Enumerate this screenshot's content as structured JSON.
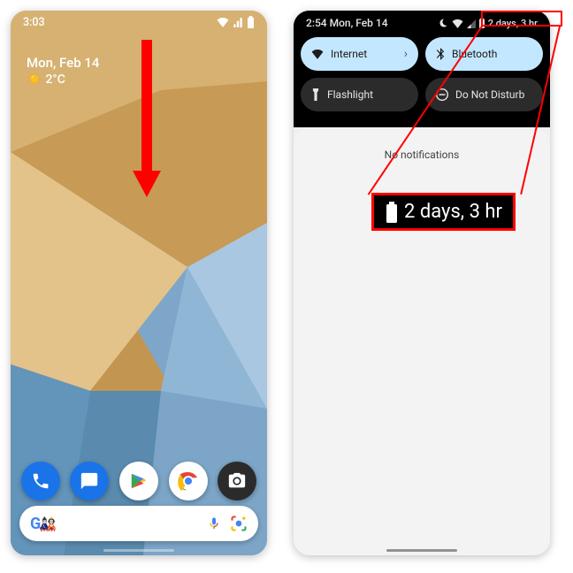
{
  "left": {
    "time": "3:03",
    "date": "Mon, Feb 14",
    "temp": "2°C",
    "dock": [
      "phone",
      "messages",
      "play",
      "chrome",
      "camera"
    ]
  },
  "right": {
    "time_date": "2:54 Mon, Feb 14",
    "battery_estimate": "2 days, 3 hr",
    "tiles": {
      "internet": "Internet",
      "bluetooth": "Bluetooth",
      "flashlight": "Flashlight",
      "dnd": "Do Not Disturb"
    },
    "no_notifications": "No notifications"
  },
  "callout": "2 days, 3 hr"
}
